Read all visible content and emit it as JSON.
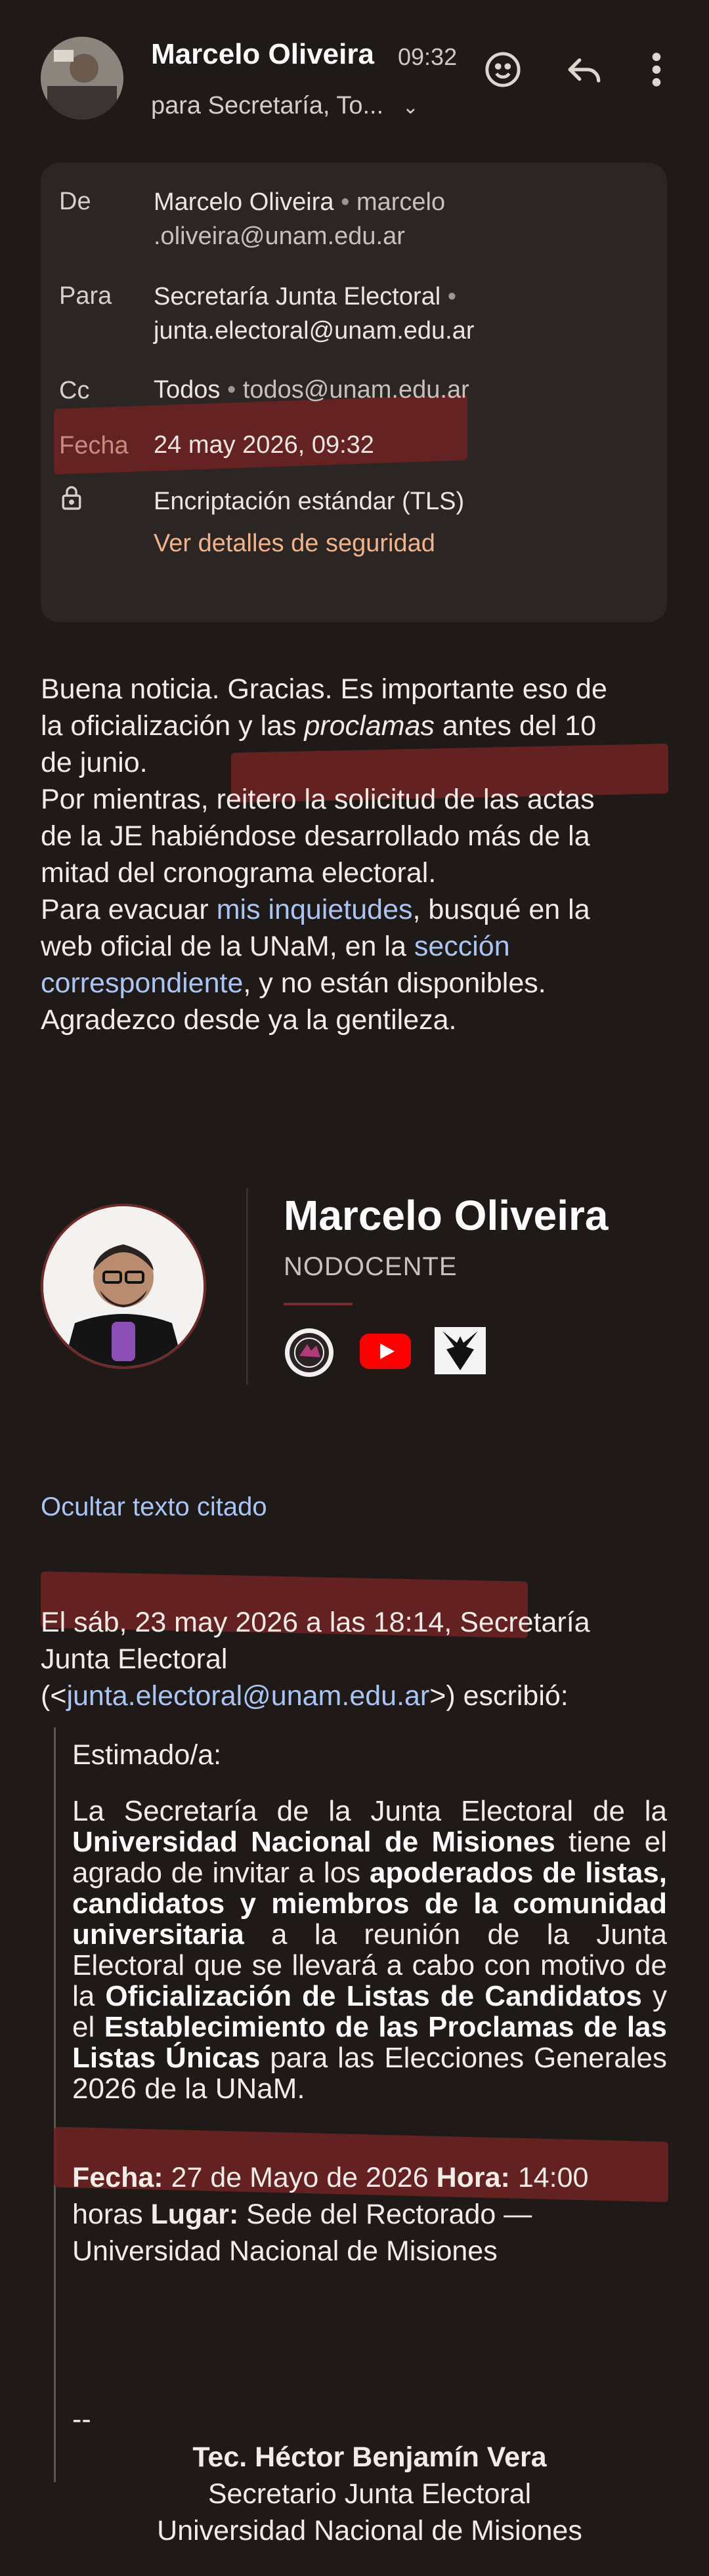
{
  "header": {
    "sender_name": "Marcelo Oliveira",
    "time": "09:32",
    "to_summary": "para Secretaría, To..."
  },
  "details": {
    "from_label": "De",
    "from_name": "Marcelo Oliveira",
    "from_email_1": "marcelo",
    "from_email_2": ".oliveira@unam.edu.ar",
    "to_label": "Para",
    "to_name": "Secretaría Junta Electoral",
    "to_email": "junta.electoral@unam.edu.ar",
    "cc_label": "Cc",
    "cc_name": "Todos",
    "cc_email": "todos@unam.edu.ar",
    "date_label": "Fecha",
    "date_value": "24 may 2026, 09:32",
    "encryption": "Encriptación estándar (TLS)",
    "security_link": "Ver detalles de seguridad",
    "dot": "•"
  },
  "body": {
    "l1": "Buena noticia. Gracias. Es importante eso de",
    "l2a": "la oficialización y las ",
    "l2b": "proclamas",
    "l2c": " antes del 10",
    "l3": "de junio.",
    "l4": "Por mientras, reitero la solicitud de las actas",
    "l5": "de la JE habiéndose desarrollado más de la",
    "l6": "mitad del cronograma electoral.",
    "l7a": "Para evacuar ",
    "l7b": "mis inquietudes",
    "l7c": ", busqué en la",
    "l8a": "web oficial de la UNaM, en la ",
    "l8b": "sección",
    "l9a": "correspondiente",
    "l9b": ", y no están disponibles.",
    "l10": "Agradezco desde ya la gentileza."
  },
  "signature": {
    "name": "Marcelo Oliveira",
    "role": "NODOCENTE"
  },
  "quoted": {
    "toggle": "Ocultar texto citado",
    "intro_1": "El sáb, 23 may 2026 a las 18:14, Secretaría",
    "intro_2": "Junta Electoral",
    "intro_3a": "(<",
    "intro_3b": "junta.electoral@unam.edu.ar",
    "intro_3c": ">) escribió:",
    "greeting": "Estimado/a:",
    "p1": "La Secretaría de la Junta Electoral de la",
    "p1b": "Universidad Nacional de Misiones",
    "p1c": " tiene el agrado de invitar a los ",
    "p1d": "apoderados de listas, candidatos y miembros de la comunidad universitaria",
    "p1e": " a la reunión de la Junta Electoral que se llevará a cabo con motivo de la ",
    "p1f": "Oficialización de Listas de Candidatos",
    "p1g": " y el ",
    "p1h": "Establecimiento de las Proclamas de las Listas Únicas",
    "p1i": " para las Elecciones Generales 2026 de la UNaM.",
    "fecha_label": "Fecha:",
    "fecha_value": " 27 de Mayo de 2026 ",
    "hora_label": "Hora:",
    "hora_value": " 14:00",
    "line2a": "horas ",
    "lugar_label": "Lugar:",
    "lugar_value": " Sede del Rectorado —",
    "line3": "Universidad Nacional de Misiones",
    "dashes": "--",
    "sig_name": "Tec. Héctor Benjamín Vera",
    "sig_role": "Secretario Junta Electoral",
    "sig_org": "Universidad Nacional de Misiones"
  }
}
